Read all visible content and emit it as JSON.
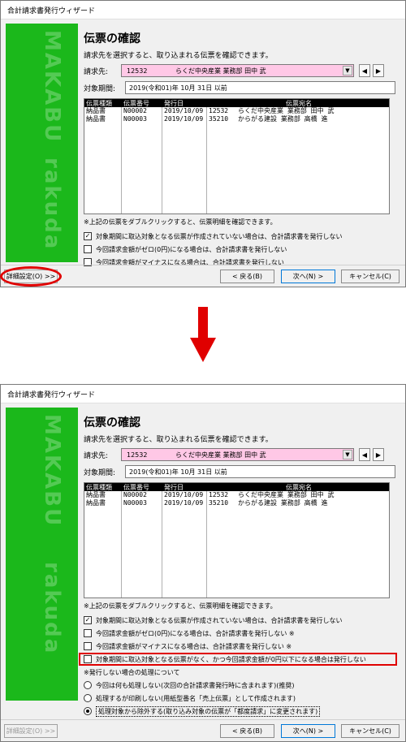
{
  "window": {
    "title": "合計請求書発行ウィザード"
  },
  "panel": {
    "text1": "MAKABU",
    "text2": "rakuda"
  },
  "page": {
    "heading": "伝票の確認",
    "description": "請求先を選択すると、取り込まれる伝票を確認できます。",
    "billing_label": "請求先:",
    "billing_code": "12532",
    "billing_name": "らくだ中央産業 業務部 田中 武",
    "period_label": "対象期間:",
    "period_value": "2019(令和01)年 10月 31日 以前"
  },
  "grid": {
    "columns": [
      "伝票種類",
      "伝票番号",
      "発行日",
      "伝票宛名"
    ],
    "rows": [
      {
        "type": "納品書",
        "number": "N00002",
        "date": "2019/10/09",
        "code": "12532",
        "name": "らくだ中央産業 業務部 田中 武"
      },
      {
        "type": "納品書",
        "number": "N00003",
        "date": "2019/10/09",
        "code": "35210",
        "name": "からがる建設 業務部 高橋 進"
      }
    ]
  },
  "note": "※上記の伝票をダブルクリックすると、伝票明細を確認できます。",
  "checks_before": [
    {
      "label": "対象期間に取込対象となる伝票が作成されていない場合は、合計請求書を発行しない",
      "checked": true
    },
    {
      "label": "今回請求金額がゼロ(0円)になる場合は、合計請求書を発行しない",
      "checked": false
    },
    {
      "label": "今回請求金額がマイナスになる場合は、合計請求書を発行しない",
      "checked": false
    }
  ],
  "checks_after": [
    {
      "label": "対象期間に取込対象となる伝票が作成されていない場合は、合計請求書を発行しない",
      "checked": true
    },
    {
      "label": "今回請求金額がゼロ(0円)になる場合は、合計請求書を発行しない ※",
      "checked": false
    },
    {
      "label": "今回請求金額がマイナスになる場合は、合計請求書を発行しない ※",
      "checked": false
    },
    {
      "label": "対象期間に取込対象となる伝票がなく、かつ今回請求金額が0円以下になる場合は発行しない",
      "checked": false
    }
  ],
  "nonissue": {
    "heading": "※発行しない場合の処理について",
    "options": [
      {
        "label": "今回は何も処理しない(次回の合計請求書発行時に含まれます)(推奨)",
        "selected": false
      },
      {
        "label": "処理するが印刷しない(用紙型番名「売上伝票」として作成されます)",
        "selected": false
      },
      {
        "label": "処理対象から除外する(取り込み対象の伝票が「都度請求」に変更されます)",
        "selected": true
      }
    ]
  },
  "buttons": {
    "detail": "詳細設定(O) >>",
    "back": "< 戻る(B)",
    "next": "次へ(N) >",
    "cancel": "キャンセル(C)"
  },
  "colors": {
    "accent_red": "#e00000",
    "panel_green": "#1bb81b",
    "billing_pink": "#ffc8e6"
  }
}
